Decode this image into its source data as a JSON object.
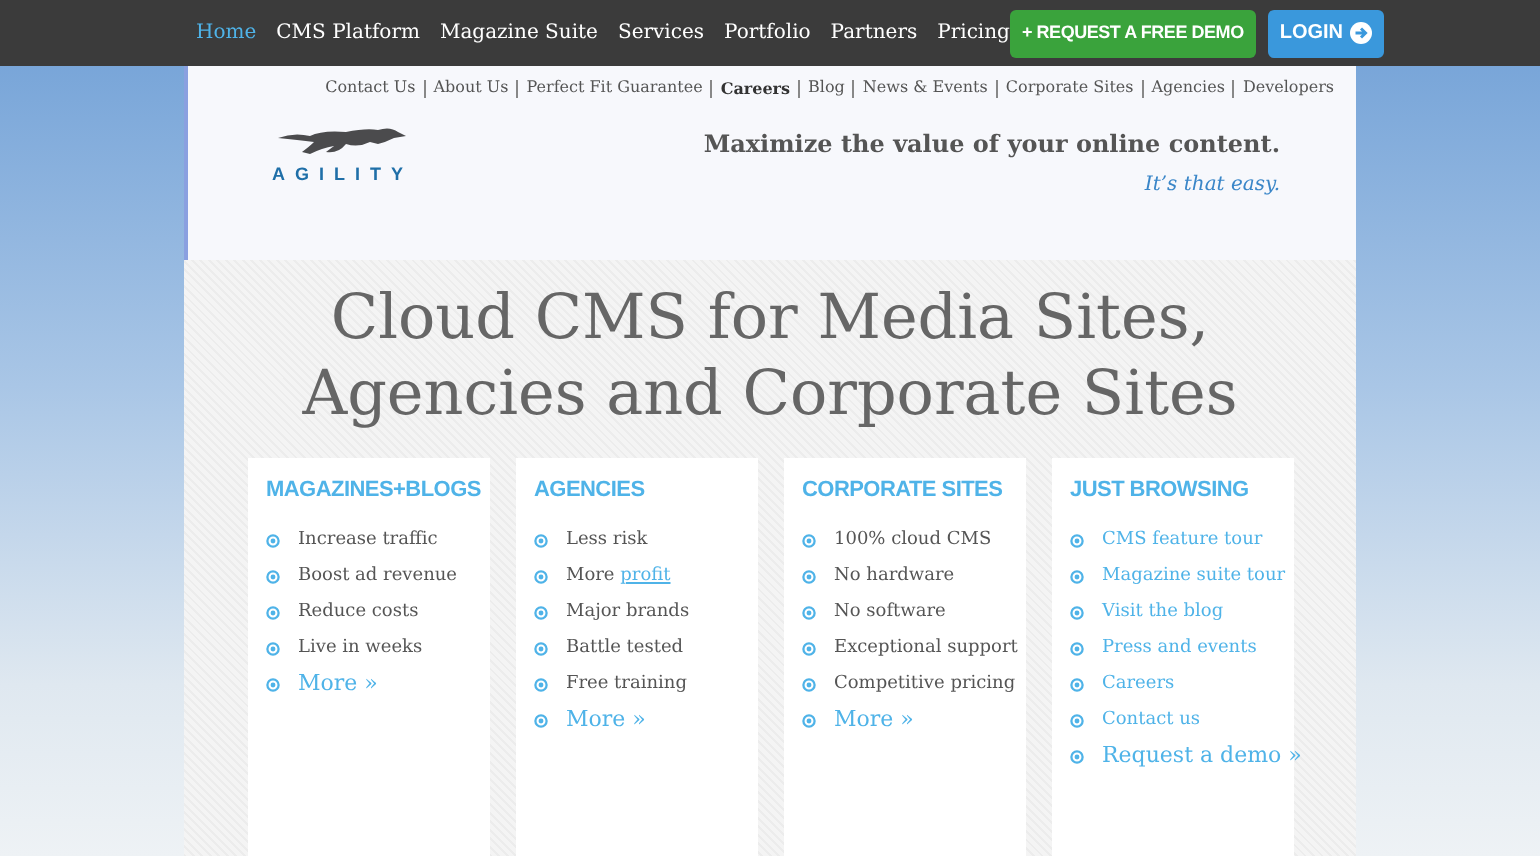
{
  "nav": {
    "items": [
      {
        "label": "Home",
        "selected": true
      },
      {
        "label": "CMS Platform",
        "selected": false
      },
      {
        "label": "Magazine Suite",
        "selected": false
      },
      {
        "label": "Services",
        "selected": false
      },
      {
        "label": "Portfolio",
        "selected": false
      },
      {
        "label": "Partners",
        "selected": false
      },
      {
        "label": "Pricing",
        "selected": false
      }
    ],
    "demo_button": "+ REQUEST A FREE DEMO",
    "login_button": "LOGIN"
  },
  "top_links": [
    {
      "label": "Contact Us",
      "selected": false
    },
    {
      "label": "About Us",
      "selected": false
    },
    {
      "label": "Perfect Fit Guarantee",
      "selected": false
    },
    {
      "label": "Careers",
      "selected": true
    },
    {
      "label": "Blog",
      "selected": false
    },
    {
      "label": "News & Events",
      "selected": false
    },
    {
      "label": "Corporate Sites",
      "selected": false
    },
    {
      "label": "Agencies",
      "selected": false
    },
    {
      "label": "Developers",
      "selected": false
    }
  ],
  "logo": {
    "text": "AGILITY"
  },
  "tagline": {
    "main": "Maximize the value of your online content.",
    "sub": "It’s that easy."
  },
  "headline": [
    "Cloud CMS for Media Sites,",
    "Agencies and Corporate Sites"
  ],
  "cards": [
    {
      "title": "MAGAZINES+BLOGS",
      "items": [
        {
          "kind": "text",
          "text": "Increase traffic"
        },
        {
          "kind": "text",
          "text": "Boost ad revenue"
        },
        {
          "kind": "text",
          "text": "Reduce costs"
        },
        {
          "kind": "text",
          "text": "Live in weeks"
        },
        {
          "kind": "more",
          "text": "More »"
        }
      ]
    },
    {
      "title": "AGENCIES",
      "items": [
        {
          "kind": "text",
          "text": "Less risk"
        },
        {
          "kind": "text",
          "text": "More",
          "link": "profit"
        },
        {
          "kind": "text",
          "text": "Major brands"
        },
        {
          "kind": "text",
          "text": "Battle tested"
        },
        {
          "kind": "text",
          "text": "Free training"
        },
        {
          "kind": "more",
          "text": "More »"
        }
      ]
    },
    {
      "title": "CORPORATE SITES",
      "items": [
        {
          "kind": "text",
          "text": "100% cloud CMS"
        },
        {
          "kind": "text",
          "text": "No hardware"
        },
        {
          "kind": "text",
          "text": "No software"
        },
        {
          "kind": "text",
          "text": "Exceptional support"
        },
        {
          "kind": "text",
          "text": "Competitive pricing"
        },
        {
          "kind": "more",
          "text": "More »"
        }
      ]
    },
    {
      "title": "JUST BROWSING",
      "items": [
        {
          "kind": "link",
          "text": "CMS feature tour"
        },
        {
          "kind": "link",
          "text": "Magazine suite tour"
        },
        {
          "kind": "link",
          "text": "Visit the blog"
        },
        {
          "kind": "link",
          "text": "Press and events"
        },
        {
          "kind": "link",
          "text": "Careers"
        },
        {
          "kind": "link",
          "text": "Contact us"
        },
        {
          "kind": "more",
          "text": "Request a demo »"
        }
      ]
    }
  ]
}
